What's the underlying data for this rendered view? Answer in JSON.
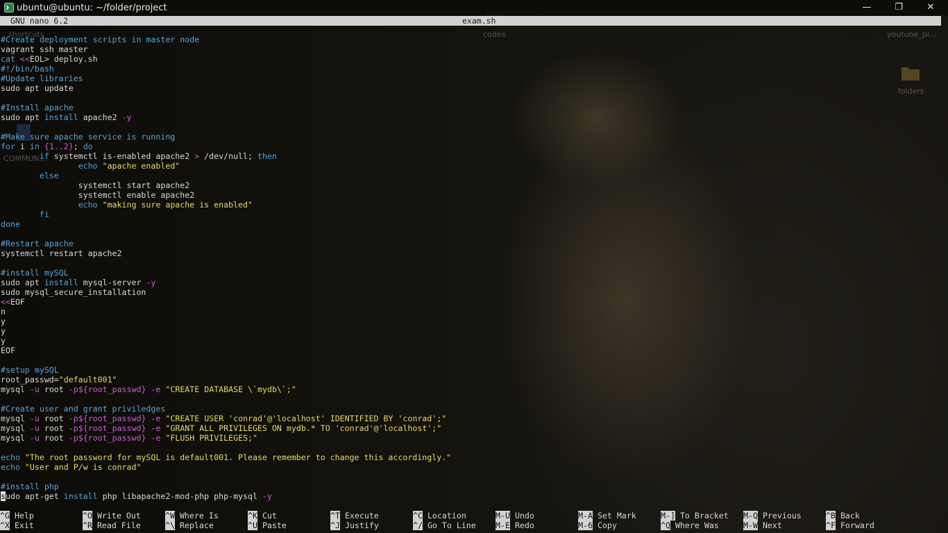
{
  "window": {
    "title": "ubuntu@ubuntu: ~/folder/project",
    "buttons": {
      "minimize": "—",
      "maximize": "❐",
      "close": "✕"
    }
  },
  "desktop": {
    "labels": [
      "shortcuts",
      "codes",
      "youtube_pl...",
      "folders",
      "COMMUN..."
    ]
  },
  "nano": {
    "version": "GNU nano 6.2",
    "filename": "exam.sh"
  },
  "lines": [
    [
      [
        "c-com",
        "#Create deployment scripts in master node"
      ]
    ],
    [
      [
        "c-plain",
        "vagrant ssh master"
      ]
    ],
    [
      [
        "c-kw",
        "cat "
      ],
      [
        "c-op",
        "<<"
      ],
      [
        "c-plain",
        "EOL> deploy.sh"
      ]
    ],
    [
      [
        "c-com",
        "#!/bin/bash"
      ]
    ],
    [
      [
        "c-com",
        "#Update libraries"
      ]
    ],
    [
      [
        "c-plain",
        "sudo apt update"
      ]
    ],
    [],
    [
      [
        "c-com",
        "#Install apache"
      ]
    ],
    [
      [
        "c-plain",
        "sudo apt "
      ],
      [
        "c-kw",
        "install"
      ],
      [
        "c-plain",
        " apache2 "
      ],
      [
        "c-op",
        "-y"
      ]
    ],
    [],
    [
      [
        "c-com",
        "#Make sure apache service is running"
      ]
    ],
    [
      [
        "c-kw",
        "for"
      ],
      [
        "c-plain",
        " i "
      ],
      [
        "c-kw",
        "in"
      ],
      [
        "c-plain",
        " "
      ],
      [
        "c-var",
        "{1..2}"
      ],
      [
        "c-plain",
        "; "
      ],
      [
        "c-kw",
        "do"
      ]
    ],
    [
      [
        "c-plain",
        "        "
      ],
      [
        "c-kw",
        "if"
      ],
      [
        "c-plain",
        " systemctl is-enabled apache2 "
      ],
      [
        "c-op",
        ">"
      ],
      [
        "c-plain",
        " /dev/null; "
      ],
      [
        "c-kw",
        "then"
      ]
    ],
    [
      [
        "c-plain",
        "                "
      ],
      [
        "c-kw",
        "echo"
      ],
      [
        "c-plain",
        " "
      ],
      [
        "c-str",
        "\"apache enabled\""
      ]
    ],
    [
      [
        "c-plain",
        "        "
      ],
      [
        "c-kw",
        "else"
      ]
    ],
    [
      [
        "c-plain",
        "                systemctl start apache2"
      ]
    ],
    [
      [
        "c-plain",
        "                systemctl enable apache2"
      ]
    ],
    [
      [
        "c-plain",
        "                "
      ],
      [
        "c-kw",
        "echo"
      ],
      [
        "c-plain",
        " "
      ],
      [
        "c-str",
        "\"making sure apache is enabled\""
      ]
    ],
    [
      [
        "c-plain",
        "        "
      ],
      [
        "c-kw",
        "fi"
      ]
    ],
    [
      [
        "c-kw",
        "done"
      ]
    ],
    [],
    [
      [
        "c-com",
        "#Restart apache"
      ]
    ],
    [
      [
        "c-plain",
        "systemctl restart apache2"
      ]
    ],
    [],
    [
      [
        "c-com",
        "#install mySQL"
      ]
    ],
    [
      [
        "c-plain",
        "sudo apt "
      ],
      [
        "c-kw",
        "install"
      ],
      [
        "c-plain",
        " mysql-server "
      ],
      [
        "c-op",
        "-y"
      ]
    ],
    [
      [
        "c-plain",
        "sudo mysql_secure_installation"
      ]
    ],
    [
      [
        "c-op",
        "<<"
      ],
      [
        "c-plain",
        "EOF"
      ]
    ],
    [
      [
        "c-plain",
        "n"
      ]
    ],
    [
      [
        "c-plain",
        "y"
      ]
    ],
    [
      [
        "c-plain",
        "y"
      ]
    ],
    [
      [
        "c-plain",
        "y"
      ]
    ],
    [
      [
        "c-plain",
        "EOF"
      ]
    ],
    [],
    [
      [
        "c-com",
        "#setup mySQL"
      ]
    ],
    [
      [
        "c-plain",
        "root_passwd="
      ],
      [
        "c-str",
        "\"default001\""
      ]
    ],
    [
      [
        "c-plain",
        "mysql "
      ],
      [
        "c-op",
        "-u"
      ],
      [
        "c-plain",
        " root "
      ],
      [
        "c-op",
        "-p"
      ],
      [
        "c-var",
        "${root_passwd}"
      ],
      [
        "c-plain",
        " "
      ],
      [
        "c-op",
        "-e"
      ],
      [
        "c-plain",
        " "
      ],
      [
        "c-str",
        "\"CREATE DATABASE \\`mydb\\`;\""
      ]
    ],
    [],
    [
      [
        "c-com",
        "#Create user and grant priviledges"
      ]
    ],
    [
      [
        "c-plain",
        "mysql "
      ],
      [
        "c-op",
        "-u"
      ],
      [
        "c-plain",
        " root "
      ],
      [
        "c-op",
        "-p"
      ],
      [
        "c-var",
        "${root_passwd}"
      ],
      [
        "c-plain",
        " "
      ],
      [
        "c-op",
        "-e"
      ],
      [
        "c-plain",
        " "
      ],
      [
        "c-str",
        "\"CREATE USER 'conrad'@'localhost' IDENTIFIED BY 'conrad';\""
      ]
    ],
    [
      [
        "c-plain",
        "mysql "
      ],
      [
        "c-op",
        "-u"
      ],
      [
        "c-plain",
        " root "
      ],
      [
        "c-op",
        "-p"
      ],
      [
        "c-var",
        "${root_passwd}"
      ],
      [
        "c-plain",
        " "
      ],
      [
        "c-op",
        "-e"
      ],
      [
        "c-plain",
        " "
      ],
      [
        "c-str",
        "\"GRANT ALL PRIVILEGES ON mydb.* TO 'conrad'@'localhost';\""
      ]
    ],
    [
      [
        "c-plain",
        "mysql "
      ],
      [
        "c-op",
        "-u"
      ],
      [
        "c-plain",
        " root "
      ],
      [
        "c-op",
        "-p"
      ],
      [
        "c-var",
        "${root_passwd}"
      ],
      [
        "c-plain",
        " "
      ],
      [
        "c-op",
        "-e"
      ],
      [
        "c-plain",
        " "
      ],
      [
        "c-str",
        "\"FLUSH PRIVILEGES;\""
      ]
    ],
    [],
    [
      [
        "c-kw",
        "echo"
      ],
      [
        "c-plain",
        " "
      ],
      [
        "c-str",
        "\"The root password for mySQL is default001. Please remember to change this accordingly.\""
      ]
    ],
    [
      [
        "c-kw",
        "echo"
      ],
      [
        "c-plain",
        " "
      ],
      [
        "c-str",
        "\"User and P/w is conrad\""
      ]
    ],
    [],
    [
      [
        "c-com",
        "#install php"
      ]
    ],
    [
      [
        "cursor",
        "s"
      ],
      [
        "c-plain",
        "udo apt-get "
      ],
      [
        "c-kw",
        "install"
      ],
      [
        "c-plain",
        " php libapache2-mod-php php-mysql "
      ],
      [
        "c-op",
        "-y"
      ]
    ]
  ],
  "shortcuts": [
    {
      "key": "^G",
      "label": "Help"
    },
    {
      "key": "^X",
      "label": "Exit"
    },
    {
      "key": "^O",
      "label": "Write Out"
    },
    {
      "key": "^R",
      "label": "Read File"
    },
    {
      "key": "^W",
      "label": "Where Is"
    },
    {
      "key": "^\\",
      "label": "Replace"
    },
    {
      "key": "^K",
      "label": "Cut"
    },
    {
      "key": "^U",
      "label": "Paste"
    },
    {
      "key": "^T",
      "label": "Execute"
    },
    {
      "key": "^J",
      "label": "Justify"
    },
    {
      "key": "^C",
      "label": "Location"
    },
    {
      "key": "^/",
      "label": "Go To Line"
    },
    {
      "key": "M-U",
      "label": "Undo"
    },
    {
      "key": "M-E",
      "label": "Redo"
    },
    {
      "key": "M-A",
      "label": "Set Mark"
    },
    {
      "key": "M-6",
      "label": "Copy"
    },
    {
      "key": "M-]",
      "label": "To Bracket"
    },
    {
      "key": "^Q",
      "label": "Where Was"
    },
    {
      "key": "M-Q",
      "label": "Previous"
    },
    {
      "key": "M-W",
      "label": "Next"
    },
    {
      "key": "^B",
      "label": "Back"
    },
    {
      "key": "^F",
      "label": "Forward"
    }
  ]
}
